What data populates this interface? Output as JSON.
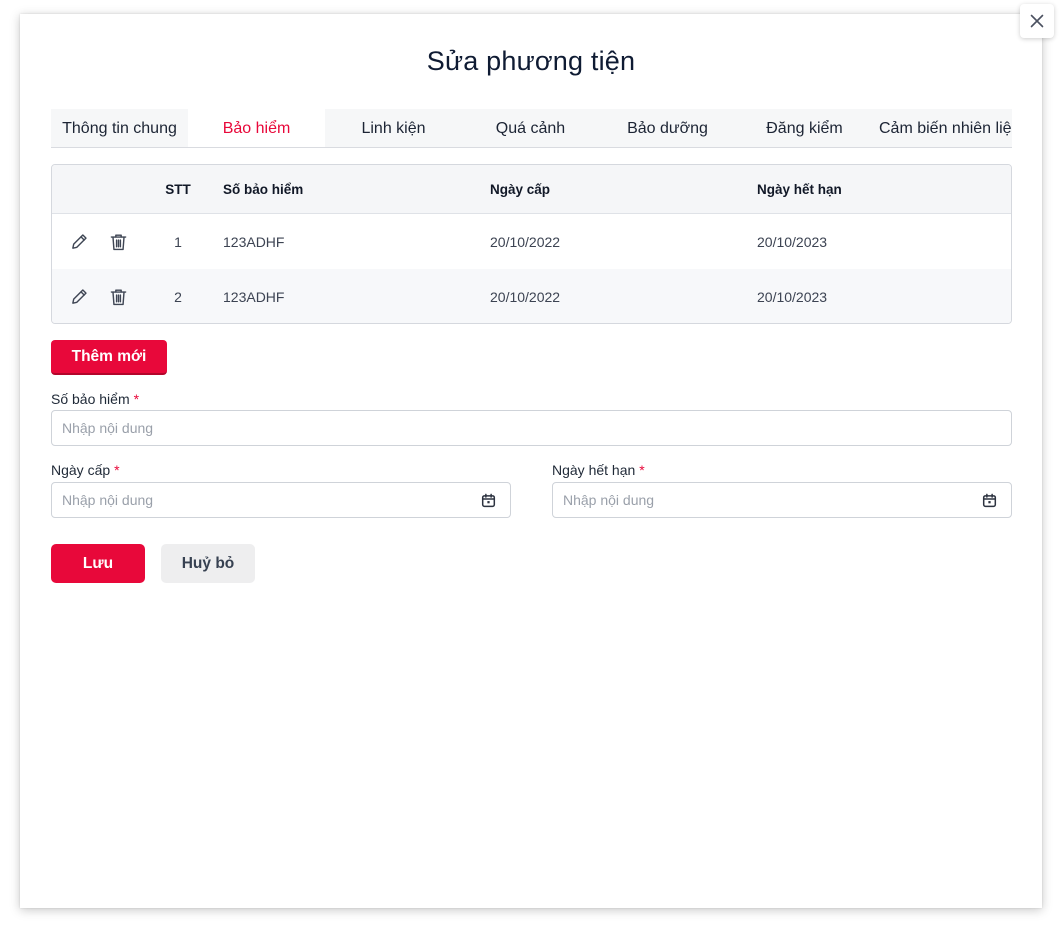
{
  "modal": {
    "title": "Sửa phương tiện"
  },
  "tabs": [
    {
      "label": "Thông tin chung",
      "active": false
    },
    {
      "label": "Bảo hiểm",
      "active": true
    },
    {
      "label": "Linh kiện",
      "active": false
    },
    {
      "label": "Quá cảnh",
      "active": false
    },
    {
      "label": "Bảo dưỡng",
      "active": false
    },
    {
      "label": "Đăng kiểm",
      "active": false
    },
    {
      "label": "Cảm biến nhiên liệu",
      "active": false
    }
  ],
  "table": {
    "headers": {
      "stt": "STT",
      "so_bao_hiem": "Số bảo hiểm",
      "ngay_cap": "Ngày cấp",
      "ngay_het_han": "Ngày hết hạn"
    },
    "rows": [
      {
        "stt": "1",
        "so_bao_hiem": "123ADHF",
        "ngay_cap": "20/10/2022",
        "ngay_het_han": "20/10/2023"
      },
      {
        "stt": "2",
        "so_bao_hiem": "123ADHF",
        "ngay_cap": "20/10/2022",
        "ngay_het_han": "20/10/2023"
      }
    ]
  },
  "actions": {
    "add_label": "Thêm mới",
    "save_label": "Lưu",
    "cancel_label": "Huỷ bỏ"
  },
  "form": {
    "so_bao_hiem": {
      "label": "Số bảo hiểm",
      "required_mark": "*",
      "value": "",
      "placeholder": "Nhập nội dung"
    },
    "ngay_cap": {
      "label": "Ngày cấp",
      "required_mark": "*",
      "value": "",
      "placeholder": "Nhập nội dung"
    },
    "ngay_het_han": {
      "label": "Ngày hết hạn",
      "required_mark": "*",
      "value": "",
      "placeholder": "Nhập nội dung"
    }
  },
  "icons": {
    "close": "close-icon",
    "edit": "pencil-icon",
    "delete": "trash-icon",
    "calendar": "calendar-icon"
  },
  "colors": {
    "accent": "#e8083a",
    "title": "#0f1b33",
    "tab_bar_bg": "#f6f7f8",
    "cancel_bg": "#eeeeef"
  }
}
